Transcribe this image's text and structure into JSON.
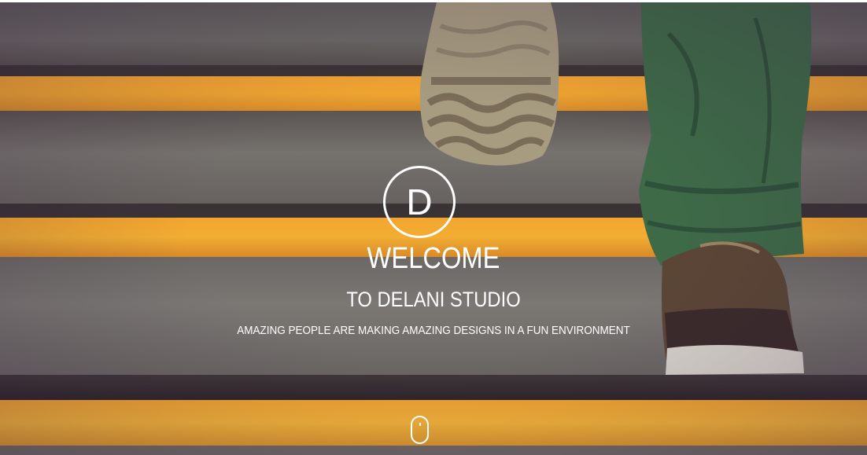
{
  "hero": {
    "logo_letter": "D",
    "title": "WELCOME",
    "subtitle": "TO DELANI STUDIO",
    "tagline": "AMAZING PEOPLE ARE MAKING AMAZING DESIGNS IN A FUN ENVIRONMENT",
    "background_image": "stairs-with-sneaker-and-green-pants",
    "scroll_icon": "mouse-scroll-icon"
  },
  "colors": {
    "text": "#ffffff",
    "stripe": "#f2a531",
    "step_gray": "#6e6a66"
  }
}
